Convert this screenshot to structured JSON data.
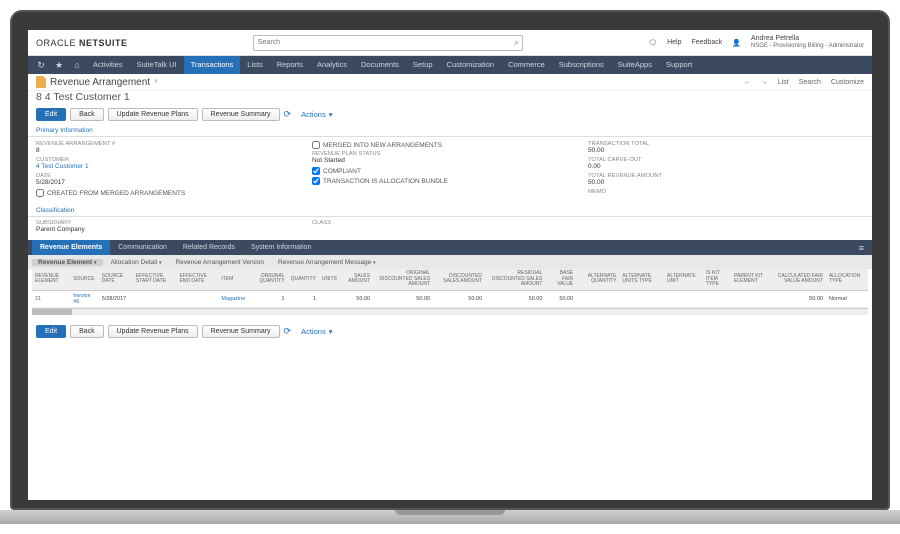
{
  "brand": {
    "oracle": "ORACLE",
    "netsuite": "NETSUITE"
  },
  "search": {
    "placeholder": "Search"
  },
  "top": {
    "help": "Help",
    "feedback": "Feedback"
  },
  "user": {
    "name": "Andrea Petrella",
    "role": "NSGE - Provisioning Billing - Administrator"
  },
  "nav": [
    "Activities",
    "SuiteTalk UI",
    "Transactions",
    "Lists",
    "Reports",
    "Analytics",
    "Documents",
    "Setup",
    "Customization",
    "Commerce",
    "Subscriptions",
    "SuiteApps",
    "Support"
  ],
  "page": {
    "title": "Revenue Arrangement",
    "id": "8",
    "customer": "4 Test Customer 1"
  },
  "header_actions": {
    "expand": "←",
    "arrow": "→",
    "list": "List",
    "search": "Search",
    "customize": "Customize"
  },
  "buttons": {
    "edit": "Edit",
    "back": "Back",
    "update": "Update Revenue Plans",
    "summary": "Revenue Summary",
    "actions": "Actions"
  },
  "sections": {
    "primary": "Primary Information",
    "classification": "Classification"
  },
  "primary": {
    "arr_label": "REVENUE ARRANGEMENT #",
    "arr_val": "8",
    "cust_label": "CUSTOMER",
    "cust_val": "4 Test Customer 1",
    "date_label": "DATE",
    "date_val": "5/28/2017",
    "created_merged": "CREATED FROM MERGED ARRANGEMENTS",
    "merged_new": "MERGED INTO NEW ARRANGEMENTS",
    "plan_status_label": "REVENUE PLAN STATUS",
    "plan_status_val": "Not Started",
    "compliant": "COMPLIANT",
    "alloc_bundle": "TRANSACTION IS ALLOCATION BUNDLE",
    "total_label": "TRANSACTION TOTAL",
    "total_val": "50.00",
    "carve_label": "TOTAL CARVE-OUT",
    "carve_val": "0.00",
    "rev_label": "TOTAL REVENUE AMOUNT",
    "rev_val": "50.00",
    "memo_label": "MEMO"
  },
  "classification": {
    "sub_label": "SUBSIDIARY",
    "sub_val": "Parent Company",
    "class_label": "CLASS"
  },
  "tabs": [
    "Revenue Elements",
    "Communication",
    "Related Records",
    "System Information"
  ],
  "subtabs": [
    "Revenue Element",
    "Allocation Detail",
    "Revenue Arrangement Version",
    "Revenue Arrangement Message"
  ],
  "columns": [
    "REVENUE ELEMENT",
    "SOURCE",
    "SOURCE DATE",
    "EFFECTIVE START DATE",
    "EFFECTIVE END DATE",
    "ITEM",
    "ORIGINAL QUANTITY",
    "QUANTITY",
    "UNITS",
    "SALES AMOUNT",
    "ORIGINAL DISCOUNTED SALES AMOUNT",
    "DISCOUNTED SALES AMOUNT",
    "RESIDUAL DISCOUNTED SALES AMOUNT",
    "BASE FAIR VALUE",
    "ALTERNATE QUANTITY",
    "ALTERNATE UNITS TYPE",
    "ALTERNATE UNIT",
    "IS KIT ITEM TYPE",
    "PARENT KIT ELEMENT",
    "CALCULATED FAIR VALUE AMOUNT",
    "ALLOCATION TYPE"
  ],
  "row": {
    "element": "21",
    "source": "Invoice #6",
    "source_date": "5/28/2017",
    "eff_start": "",
    "eff_end": "",
    "item": "Magazine",
    "orig_qty": "1",
    "qty": "1",
    "units": "",
    "sales": "50.00",
    "orig_disc": "50.00",
    "disc": "50.00",
    "resid": "50.00",
    "base_fv": "50.00",
    "alt_qty": "",
    "alt_ut": "",
    "alt_u": "",
    "kit": "",
    "parent_kit": "",
    "calc_fv": "50.00",
    "alloc": "Normal"
  }
}
